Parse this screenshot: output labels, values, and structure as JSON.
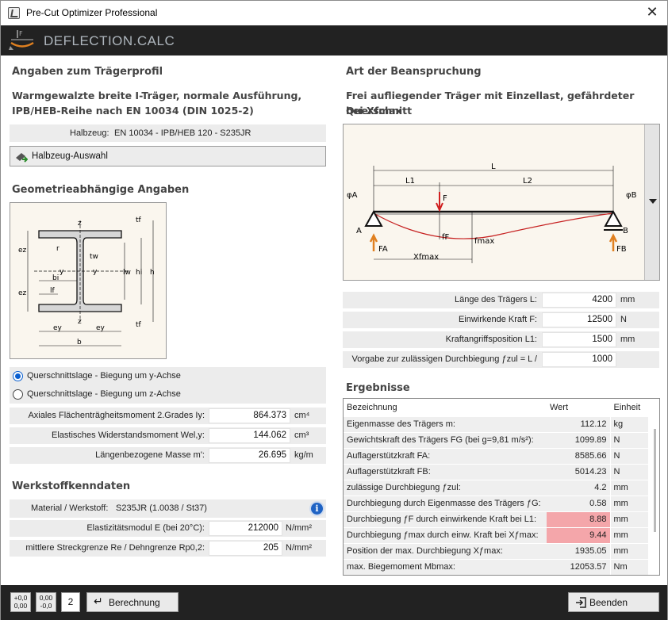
{
  "window": {
    "title": "Pre-Cut Optimizer Professional",
    "close": "✕"
  },
  "header": {
    "title": "DEFLECTION.CALC"
  },
  "left": {
    "profile_heading": "Angaben zum Trägerprofil",
    "profile_desc_1": "Warmgewalzte breite I-Träger, normale Ausführung,",
    "profile_desc_2": "IPB/HEB-Reihe nach EN 10034 (DIN 1025-2)",
    "halbzeug_label": "Halbzeug:",
    "halbzeug_value": "EN 10034 - IPB/HEB 120 - S235JR",
    "halbzeug_button": "Halbzeug-Auswahl",
    "geo_heading": "Geometrieabhängige Angaben",
    "radio_y": "Querschnittslage - Biegung um y-Achse",
    "radio_z": "Querschnittslage - Biegung um z-Achse",
    "fields": [
      {
        "label": "Axiales Flächenträgheitsmoment 2.Grades Iy:",
        "value": "864.373",
        "unit": "cm⁴"
      },
      {
        "label": "Elastisches Widerstandsmoment Wel,y:",
        "value": "144.062",
        "unit": "cm³"
      },
      {
        "label": "Längenbezogene Masse m':",
        "value": "26.695",
        "unit": "kg/m"
      }
    ],
    "werkstoff_heading": "Werkstoffkenndaten",
    "material_label": "Material / Werkstoff:",
    "material_value": "S235JR (1.0038 / St37)",
    "info_icon": "i",
    "mat_fields": [
      {
        "label": "Elastizitätsmodul E (bei 20°C):",
        "value": "212000",
        "unit": "N/mm²"
      },
      {
        "label": "mittlere Streckgrenze Re / Dehngrenze Rp0,2:",
        "value": "205",
        "unit": "N/mm²"
      }
    ]
  },
  "diagram": {
    "top": "z",
    "bottom": "z",
    "y_left": "y",
    "y_right": "y",
    "tf_top": "tf",
    "tf_bot": "tf",
    "tw": "tw",
    "r": "r",
    "lw": "lw",
    "hi": "hi",
    "h": "h",
    "ez_top": "ez",
    "ez_bot": "ez",
    "bi": "bi",
    "lf": "lf",
    "ey1": "ey",
    "ey2": "ey",
    "b": "b"
  },
  "right": {
    "load_heading": "Art der Beanspruchung",
    "load_desc_1": "Frei aufliegender Träger mit Einzellast, gefährdeter Querschnitt",
    "load_desc_2": "bei Xfmax",
    "beam": {
      "L": "L",
      "L1": "L1",
      "L2": "L2",
      "F": "F",
      "phiA": "φA",
      "phiB": "φB",
      "A": "A",
      "B": "B",
      "FA": "FA",
      "FB": "FB",
      "fF": "fF",
      "fmax": "fmax",
      "Xfmax": "Xfmax"
    },
    "fields": [
      {
        "label": "Länge des Trägers L:",
        "value": "4200",
        "unit": "mm"
      },
      {
        "label": "Einwirkende Kraft F:",
        "value": "12500",
        "unit": "N"
      },
      {
        "label": "Kraftangriffsposition L1:",
        "value": "1500",
        "unit": "mm"
      },
      {
        "label": "Vorgabe zur zulässigen Durchbiegung ƒzul = L /",
        "value": "1000",
        "unit": ""
      }
    ],
    "results_heading": "Ergebnisse",
    "results_header": [
      "Bezeichnung",
      "Wert",
      "Einheit"
    ],
    "results": [
      {
        "name": "Eigenmasse des Trägers m:",
        "value": "112.12",
        "unit": "kg",
        "warn": false
      },
      {
        "name": "Gewichtskraft des Trägers FG (bei g=9,81 m/s²):",
        "value": "1099.89",
        "unit": "N",
        "warn": false
      },
      {
        "name": "Auflagerstützkraft FA:",
        "value": "8585.66",
        "unit": "N",
        "warn": false
      },
      {
        "name": "Auflagerstützkraft FB:",
        "value": "5014.23",
        "unit": "N",
        "warn": false
      },
      {
        "name": "zulässige Durchbiegung ƒzul:",
        "value": "4.2",
        "unit": "mm",
        "warn": false
      },
      {
        "name": "Durchbiegung durch Eigenmasse des Trägers ƒG:",
        "value": "0.58",
        "unit": "mm",
        "warn": false
      },
      {
        "name": "Durchbiegung ƒF durch einwirkende Kraft bei L1:",
        "value": "8.88",
        "unit": "mm",
        "warn": true
      },
      {
        "name": "Durchbiegung ƒmax durch einw. Kraft bei Xƒmax:",
        "value": "9.44",
        "unit": "mm",
        "warn": true
      },
      {
        "name": "Position der max. Durchbiegung Xƒmax:",
        "value": "1935.05",
        "unit": "mm",
        "warn": false
      },
      {
        "name": "max. Biegemoment Mbmax:",
        "value": "12053.57",
        "unit": "Nm",
        "warn": false
      }
    ]
  },
  "footer": {
    "dec_plus_1": "+0,0",
    "dec_plus_2": "0,00",
    "dec_minus_1": "0,00",
    "dec_minus_2": "-0,0",
    "decimals": "2",
    "calc": "Berechnung",
    "quit": "Beenden"
  }
}
